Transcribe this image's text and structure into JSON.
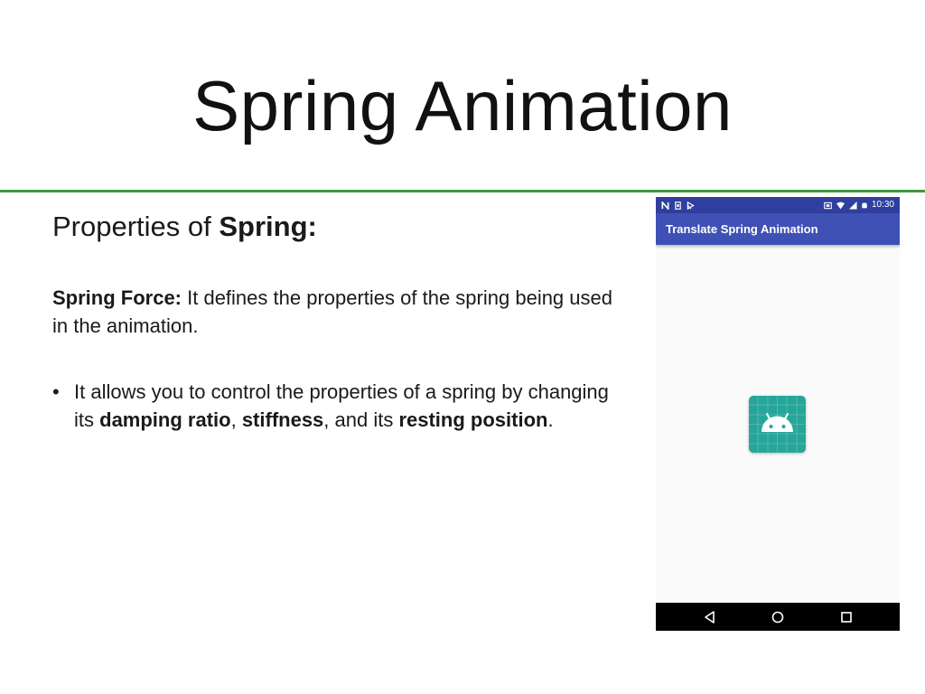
{
  "slide": {
    "title": "Spring Animation",
    "subheading_prefix": "Properties of ",
    "subheading_bold": "Spring:",
    "paragraph": {
      "term": "Spring Force:",
      "text": " It defines the properties of the spring being used in the animation."
    },
    "bullet": {
      "symbol": "•",
      "part1": "It allows you to control the properties of a spring by changing its ",
      "bold1": "damping ratio",
      "part2": ", ",
      "bold2": "stiffness",
      "part3": ", and its ",
      "bold3": "resting position",
      "part4": "."
    },
    "rule_color": "#3e9a3a"
  },
  "phone": {
    "status_bar": {
      "time": "10:30",
      "left_icons": [
        "n-notification-icon",
        "sim-icon",
        "media-icon"
      ],
      "right_icons": [
        "vibrate-icon",
        "wifi-icon",
        "signal-icon",
        "battery-icon"
      ],
      "color": "#303f9f"
    },
    "app_bar": {
      "title": "Translate Spring Animation",
      "color": "#3f51b5"
    },
    "content_icon": "android-icon",
    "icon_color": "#26a69a",
    "nav_bar": {
      "buttons": [
        "back-icon",
        "home-icon",
        "recents-icon"
      ]
    }
  }
}
